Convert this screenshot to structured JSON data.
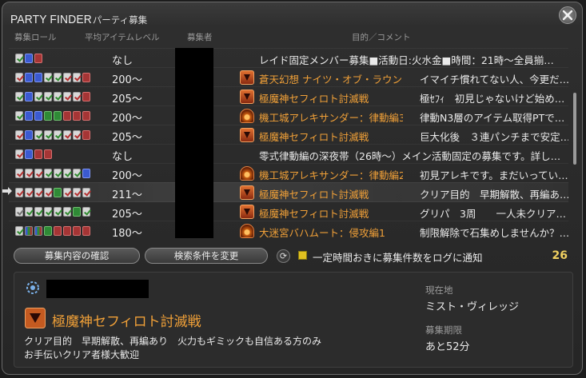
{
  "window": {
    "title": "PARTY FINDER",
    "subtitle": "パーティ募集"
  },
  "columns": {
    "roles": "募集ロール",
    "item_level": "平均アイテムレベル",
    "recruiter": "募集者",
    "purpose": "目的／コメント"
  },
  "listings": [
    {
      "roles": [
        "check",
        "tank",
        "dps"
      ],
      "level": "なし",
      "duty": "",
      "duty_icon": "",
      "comment": "レイド固定メンバー募集■活動日:火水金■時間：21時～全員揃…"
    },
    {
      "roles": [
        "check-red",
        "tank",
        "tank",
        "check",
        "check",
        "check-red",
        "check-red",
        "dps"
      ],
      "level": "200～",
      "duty": "蒼天幻想 ナイツ・オブ・ラウンド…",
      "duty_icon": "trial",
      "comment": "イマイチ慣れてない人、今更だ…"
    },
    {
      "roles": [
        "check",
        "tank",
        "check",
        "check",
        "check",
        "check-red",
        "check-red",
        "dps"
      ],
      "level": "205～",
      "duty": "極魔神セフィロト討滅戦",
      "duty_icon": "trial",
      "comment": "極ｾﾌｨ　初見じゃないけど始め…"
    },
    {
      "roles": [
        "check",
        "tank",
        "tank",
        "heal",
        "heal",
        "dps",
        "dps",
        "dps"
      ],
      "level": "200～",
      "duty": "機工城アレキサンダー：律動編3",
      "duty_icon": "raid",
      "comment": "律動N3層のアイテム取得PTで…"
    },
    {
      "roles": [
        "check-red",
        "tank",
        "check",
        "check",
        "check",
        "check-red",
        "check-red",
        "dps"
      ],
      "level": "205～",
      "duty": "極魔神セフィロト討滅戦",
      "duty_icon": "trial",
      "comment": "巨大化後　３連パンチまで安定…"
    },
    {
      "roles": [
        "check-red",
        "tank",
        "dps",
        "dps"
      ],
      "level": "なし",
      "duty": "",
      "duty_icon": "",
      "comment": "零式律動編の深夜帯（26時～）メイン活動固定の募集です。詳し…"
    },
    {
      "roles": [
        "check-red",
        "check-red",
        "check-red",
        "check",
        "check",
        "check",
        "check",
        "tank"
      ],
      "level": "200～",
      "duty": "機工城アレキサンダー：律動編2",
      "duty_icon": "raid",
      "comment": "初見アレキです。まだいってい…"
    },
    {
      "roles": [
        "check-red",
        "check-red",
        "check-red",
        "check-red",
        "heal",
        "check-red",
        "check-red",
        "check-red"
      ],
      "level": "211～",
      "duty": "極魔神セフィロト討滅戦",
      "duty_icon": "trial",
      "comment": "クリア目的　早期解散、再編あ…",
      "selected": true
    },
    {
      "roles": [
        "check-grey",
        "check",
        "check",
        "check",
        "check",
        "check",
        "heal",
        "check"
      ],
      "level": "205～",
      "duty": "極魔神セフィロト討滅戦",
      "duty_icon": "trial",
      "comment": "グリパ　3周　　一人未クリア…"
    },
    {
      "roles": [
        "check",
        "all",
        "all",
        "heal",
        "dps",
        "dps",
        "dps",
        "dps"
      ],
      "level": "180～",
      "duty": "大迷宮バハムート：侵攻編1",
      "duty_icon": "raid",
      "comment": "制限解除で石集めしませんか？…"
    }
  ],
  "actions": {
    "view_button": "募集内容の確認",
    "search_button": "検索条件を変更",
    "notify_label": "一定時間おきに募集件数をログに通知",
    "count": "26"
  },
  "detail": {
    "duty": "極魔神セフィロト討滅戦",
    "comment_line1": "クリア目的　早期解散、再編あり　火力もギミックも自信ある方のみ",
    "comment_line2": "お手伝いクリア者様大歓迎",
    "location_label": "現在地",
    "location": "ミスト・ヴィレッジ",
    "expiry_label": "募集期限",
    "expiry": "あと52分"
  }
}
